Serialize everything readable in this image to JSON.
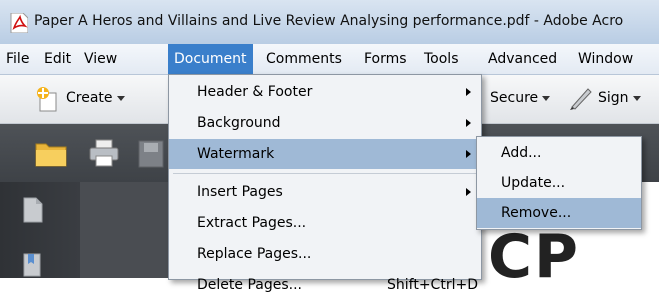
{
  "window": {
    "title": "Paper A Heros and Villains and Live Review Analysing performance.pdf - Adobe Acro"
  },
  "menubar": {
    "items": [
      {
        "label": "File"
      },
      {
        "label": "Edit"
      },
      {
        "label": "View"
      },
      {
        "label": "Document",
        "active": true
      },
      {
        "label": "Comments"
      },
      {
        "label": "Forms"
      },
      {
        "label": "Tools"
      },
      {
        "label": "Advanced"
      },
      {
        "label": "Window"
      }
    ]
  },
  "toolbar": {
    "create_label": "Create",
    "secure_label": "Secure",
    "sign_label": "Sign"
  },
  "document_menu": {
    "items": [
      {
        "label": "Header & Footer",
        "has_submenu": true
      },
      {
        "label": "Background",
        "has_submenu": true
      },
      {
        "label": "Watermark",
        "has_submenu": true,
        "highlighted": true
      },
      {
        "label": "Insert Pages",
        "has_submenu": true
      },
      {
        "label": "Extract Pages..."
      },
      {
        "label": "Replace Pages..."
      },
      {
        "label": "Delete Pages...",
        "shortcut": "Shift+Ctrl+D"
      }
    ]
  },
  "watermark_submenu": {
    "items": [
      {
        "label": "Add..."
      },
      {
        "label": "Update..."
      },
      {
        "label": "Remove...",
        "highlighted": true
      }
    ]
  },
  "page_preview": {
    "text": "CP"
  },
  "colors": {
    "menu_active": "#3a7fcb",
    "menu_highlight": "#9fb9d6",
    "dark_toolbar": "#45494e"
  }
}
